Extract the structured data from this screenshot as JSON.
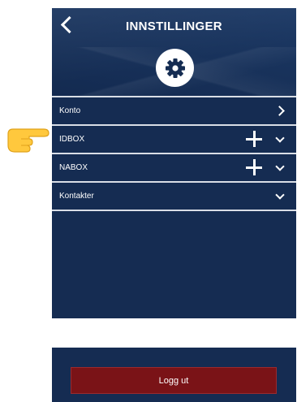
{
  "header": {
    "title": "INNSTILLINGER"
  },
  "icons": {
    "back": "chevron-left-icon",
    "settings": "gear-icon",
    "pointer": "pointing-hand-icon"
  },
  "list": {
    "items": [
      {
        "label": "Konto",
        "trailing": "chevron-right-icon"
      },
      {
        "label": "IDBOX",
        "trailing": "chevron-down-icon",
        "add": true
      },
      {
        "label": "NABOX",
        "trailing": "chevron-down-icon",
        "add": true
      },
      {
        "label": "Kontakter",
        "trailing": "chevron-down-icon"
      }
    ]
  },
  "footer": {
    "logout_label": "Logg ut"
  },
  "colors": {
    "background": "#152c52",
    "logout": "#7a1317",
    "divider": "#d9dee6"
  }
}
